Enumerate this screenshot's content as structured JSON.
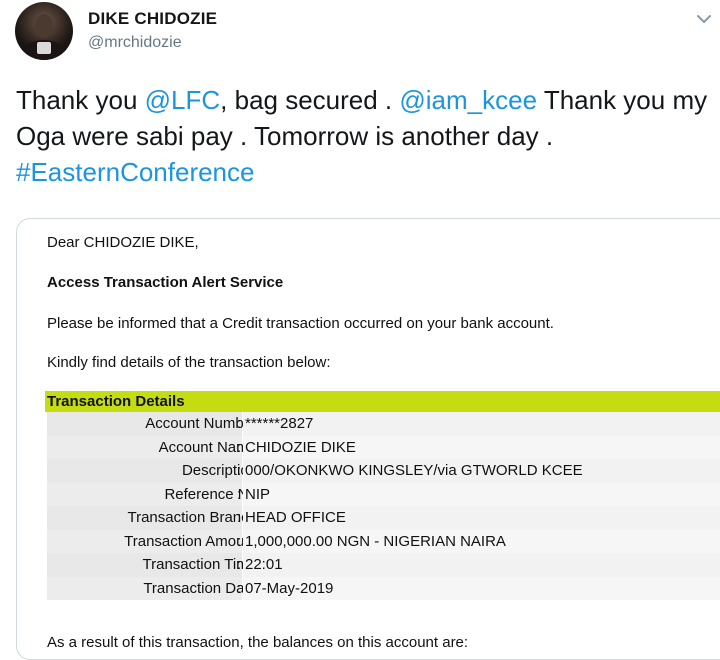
{
  "author": {
    "name": "DIKE CHIDOZIE",
    "handle": "@mrchidozie"
  },
  "tweet": {
    "segments": [
      {
        "text": "Thank you ",
        "type": "text"
      },
      {
        "text": "@LFC",
        "type": "mention"
      },
      {
        "text": ", bag secured . ",
        "type": "text"
      },
      {
        "text": "@iam_kcee",
        "type": "mention"
      },
      {
        "text": " Thank you my Oga were sabi pay . Tomorrow is another day . ",
        "type": "text"
      },
      {
        "text": "#EasternConference",
        "type": "hashtag"
      }
    ]
  },
  "email": {
    "greeting": "Dear CHIDOZIE DIKE,",
    "service": "Access Transaction Alert Service",
    "informed": "Please be informed that a Credit transaction occurred on your bank account.",
    "kindly": "Kindly find details of the transaction below:",
    "tx_header": "Transaction Details",
    "rows": [
      {
        "label": "Account Number",
        "value": "******2827"
      },
      {
        "label": "Account Name",
        "value": "CHIDOZIE DIKE"
      },
      {
        "label": "Description",
        "value": "000/OKONKWO KINGSLEY/via GTWORLD KCEE"
      },
      {
        "label": "Reference No",
        "value": "NIP"
      },
      {
        "label": "Transaction Branch",
        "value": "HEAD OFFICE"
      },
      {
        "label": "Transaction Amount",
        "value": "1,000,000.00 NGN - NIGERIAN NAIRA"
      },
      {
        "label": "Transaction Time",
        "value": "22:01"
      },
      {
        "label": "Transaction Date",
        "value": "07-May-2019"
      }
    ],
    "result": "As a result of this transaction, the balances on this account are:"
  },
  "colors": {
    "link": "#1b95e0",
    "header_bar": "#c5dc12",
    "handle": "#657786"
  },
  "icons": {
    "avatar": "profile-photo",
    "menu": "chevron-down-icon"
  }
}
